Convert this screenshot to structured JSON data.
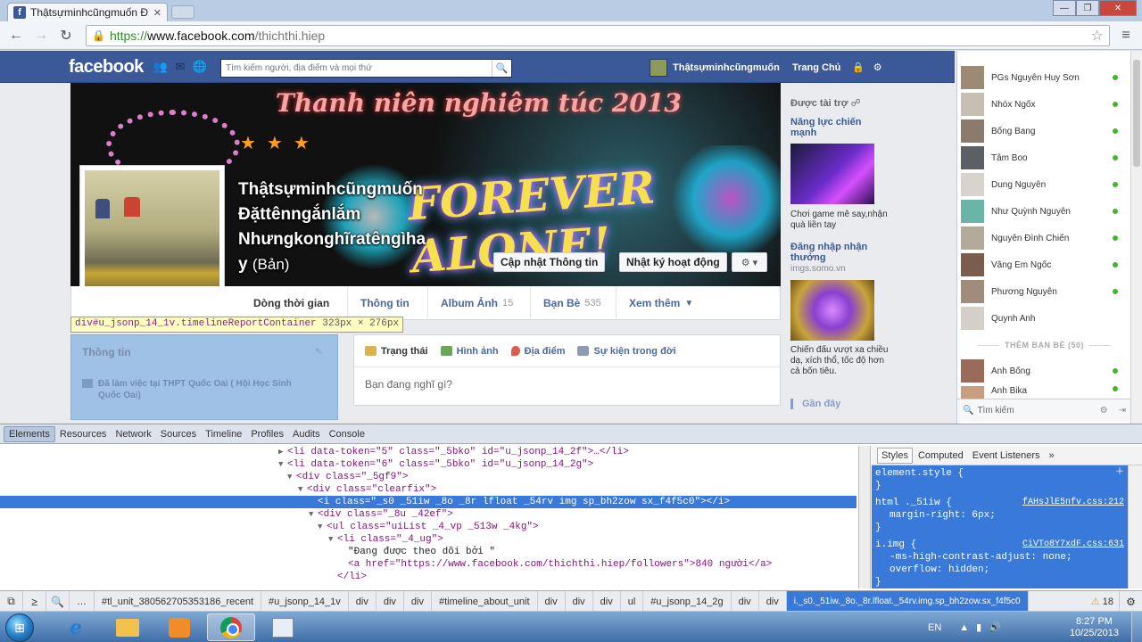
{
  "browser": {
    "tab_title": "Thậtsựminhcũngmuốn Đ",
    "url_https": "https://",
    "url_host": "www.facebook.com",
    "url_path": "/thichthi.hiep"
  },
  "fb": {
    "logo": "facebook",
    "search_placeholder": "Tìm kiếm người, địa điểm và mọi thứ",
    "profile_name": "Thậtsựminhcũngmuốn",
    "home": "Trang Chủ"
  },
  "cover": {
    "banner": "Thanh niên nghiêm túc 2013",
    "forever": "FOREVER ALONE!",
    "name_l1": "Thậtsựminhcũngmuốn",
    "name_l2": "Đặttênngắnlắm",
    "name_l3": "Nhưngkonghĩratêngìha",
    "name_l4": "y",
    "name_sub": "(Bản)",
    "btn_update": "Cập nhật Thông tin",
    "btn_activity": "Nhật ký hoạt động",
    "btn_gear": "⚙ ▾"
  },
  "profile_tabs": [
    {
      "label": "Dòng thời gian",
      "count": ""
    },
    {
      "label": "Thông tin",
      "count": ""
    },
    {
      "label": "Album Ảnh",
      "count": "15"
    },
    {
      "label": "Bạn Bè",
      "count": "535"
    },
    {
      "label": "Xem thêm",
      "count": ""
    }
  ],
  "inspect_tooltip": {
    "selector": "div#u_jsonp_14_1v.timelineReportContainer",
    "size": "323px × 276px"
  },
  "intro": {
    "title": "Thông tin",
    "item": "Đã làm việc tại THPT Quốc Oai ( Hội Học Sinh Quốc Oai)"
  },
  "composer": {
    "tabs": [
      "Trạng thái",
      "Hình ảnh",
      "Địa điểm",
      "Sự kiện trong đời"
    ],
    "placeholder": "Bạn đang nghĩ gì?"
  },
  "ads": {
    "header": "Được tài trợ",
    "ad1_title": "Năng lực chiến mạnh",
    "ad1_desc": "Chơi game mê say,nhận quà liền tay",
    "ad2_title": "Đăng nhập nhận thưởng",
    "ad2_url": "imgs.somo.vn",
    "ad2_desc": "Chiến đấu vượt xa chiều dạ, xích thổ, tốc độ hơn cả bốn tiêu.",
    "recent": "Gần đây"
  },
  "chat": {
    "friends": [
      "PGs Nguyễn Huy Sơn",
      "Nhóx Ngốx",
      "Bống Bang",
      "Tâm Boo",
      "Dung Nguyễn",
      "Như Quỳnh Nguyễn",
      "Nguyễn Đình Chiến",
      "Vâng Em Ngốc",
      "Phương Nguyễn",
      "Quynh Anh"
    ],
    "more_label": "THÊM BẠN BÈ (50)",
    "extra": [
      "Ánh Bống",
      "Anh Bika"
    ],
    "search": "Tìm kiếm"
  },
  "devtools": {
    "tabs": [
      "Elements",
      "Resources",
      "Network",
      "Sources",
      "Timeline",
      "Profiles",
      "Audits",
      "Console"
    ],
    "dom": [
      "<li data-token=\"5\" class=\"_5bko\" id=\"u_jsonp_14_2f\">…</li>",
      "<li data-token=\"6\" class=\"_5bko\" id=\"u_jsonp_14_2g\">",
      "<div class=\"_5gf9\">",
      "<div class=\"clearfix\">",
      "<i class=\"_s0 _51iw _8o _8r lfloat _54rv img sp_bh2zow sx_f4f5c0\"></i>",
      "<div class=\"_8u _42ef\">",
      "<ul class=\"uiList _4_vp _513w _4kg\">",
      "<li class=\"_4_ug\">",
      "\"Đang được theo dõi bởi \"",
      "<a href=\"https://www.facebook.com/thichthi.hiep/followers\">840 người</a>",
      "</li>"
    ],
    "style_tabs": [
      "Styles",
      "Computed",
      "Event Listeners"
    ],
    "rule1_sel": "element.style {",
    "rule1_close": "}",
    "rule2_sel": "html ._51iw {",
    "rule2_src": "fAHsJlE5nfv.css:212",
    "rule2_prop": "margin-right: 6px;",
    "rule2_close": "}",
    "rule3_sel": "i.img {",
    "rule3_src": "CiVTo8Y7xdF.css:631",
    "rule3_prop1": "-ms-high-contrast-adjust: none;",
    "rule3_prop2": "overflow: hidden;",
    "rule3_close": "}",
    "crumbs": [
      "#tl_unit_380562705353186_recent",
      "#u_jsonp_14_1v",
      "div",
      "div",
      "div",
      "#timeline_about_unit",
      "div",
      "div",
      "div",
      "ul",
      "#u_jsonp_14_2g",
      "div",
      "div"
    ],
    "crumb_selected": "i._s0._51iw._8o._8r.lfloat._54rv.img.sp_bh2zow.sx_f4f5c0",
    "warnings": "18"
  },
  "taskbar": {
    "lang": "EN",
    "time": "8:27 PM",
    "date": "10/25/2013"
  }
}
